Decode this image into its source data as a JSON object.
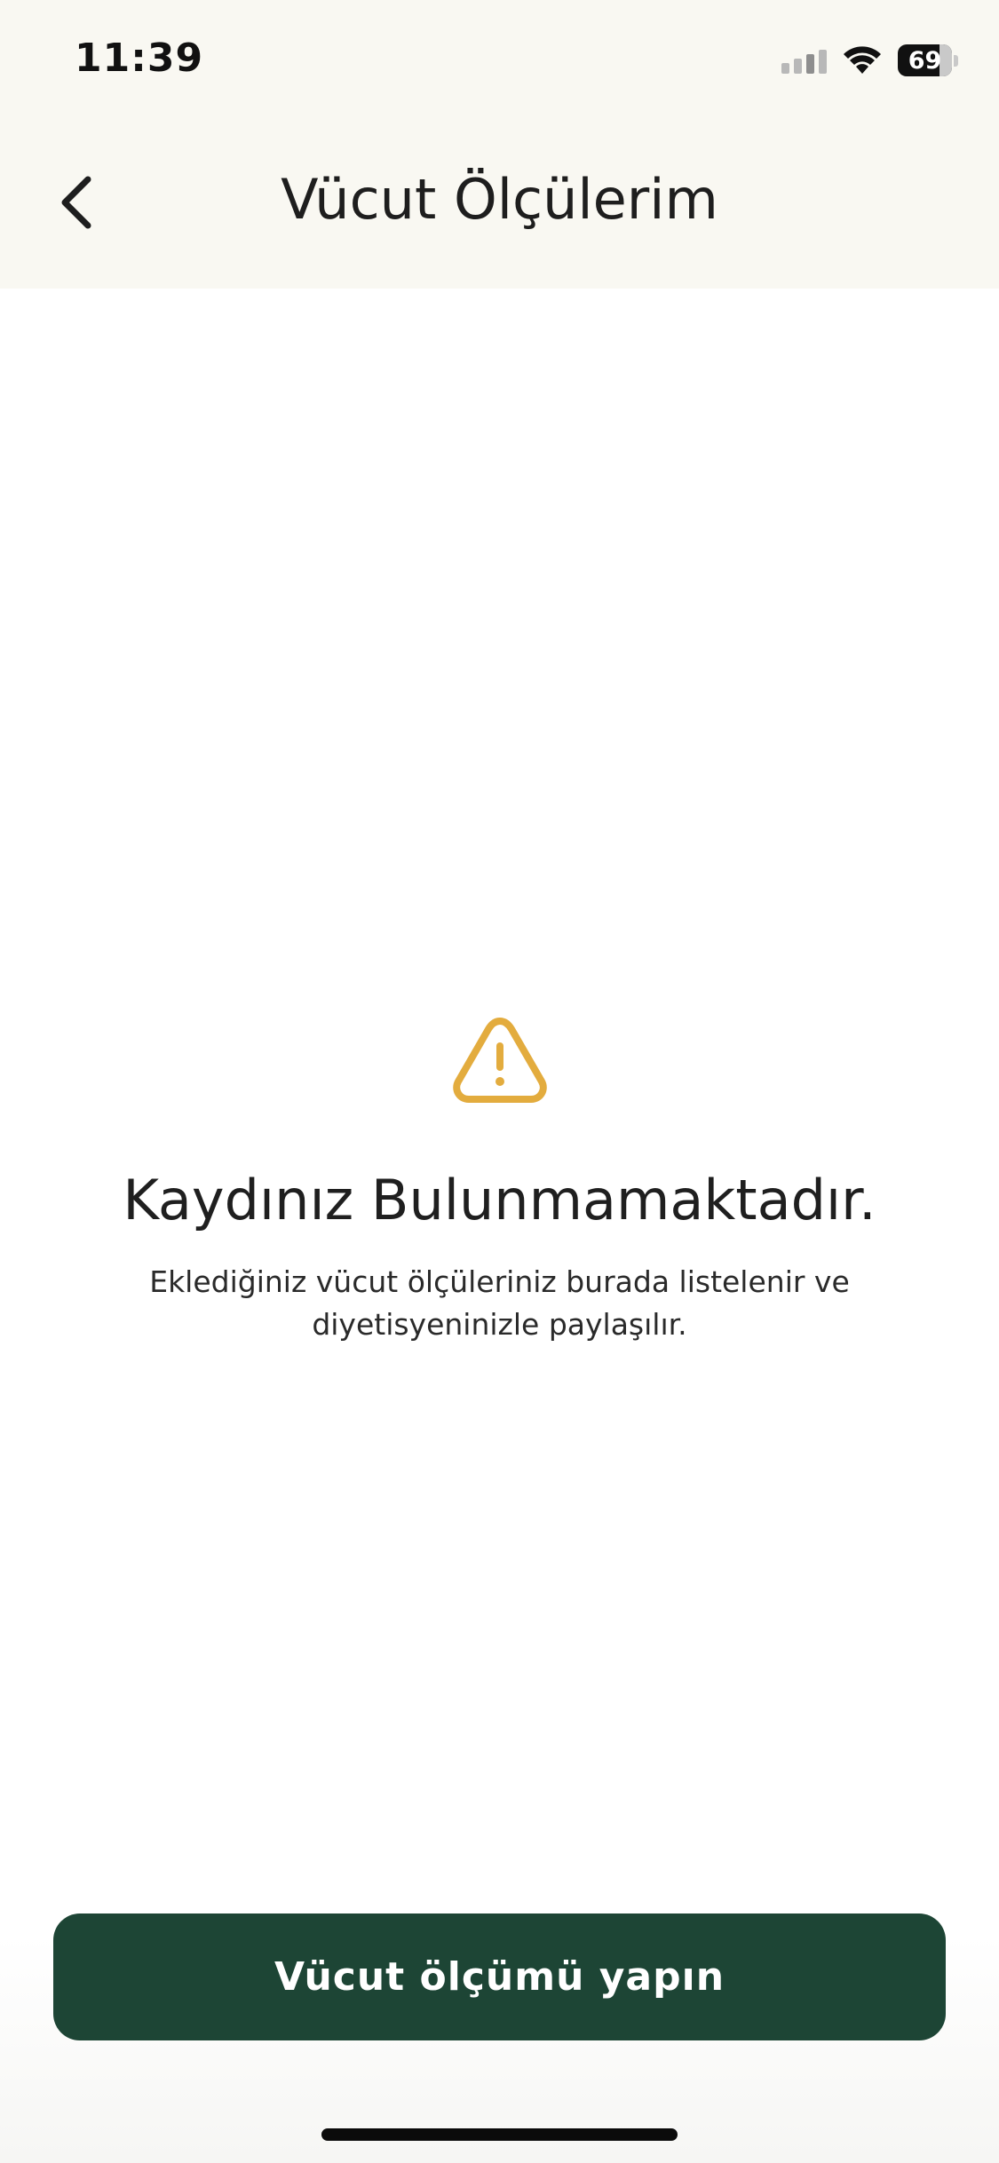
{
  "status_bar": {
    "time": "11:39",
    "battery": "69",
    "icons": [
      "cellular-signal-icon",
      "wifi-icon",
      "battery-icon"
    ]
  },
  "header": {
    "title": "Vücut Ölçülerim",
    "back_icon": "chevron-left-icon"
  },
  "empty_state": {
    "icon": "warning-triangle-icon",
    "title": "Kaydınız Bulunmamaktadır.",
    "description": "Eklediğiniz vücut ölçüleriniz burada listelenir ve diyetisyeninizle paylaşılır."
  },
  "actions": {
    "primary_label": "Vücut ölçümü yapın"
  },
  "colors": {
    "header_bg": "#f9f8f2",
    "accent_warning": "#e3ac3e",
    "primary_button": "#1d4535"
  }
}
